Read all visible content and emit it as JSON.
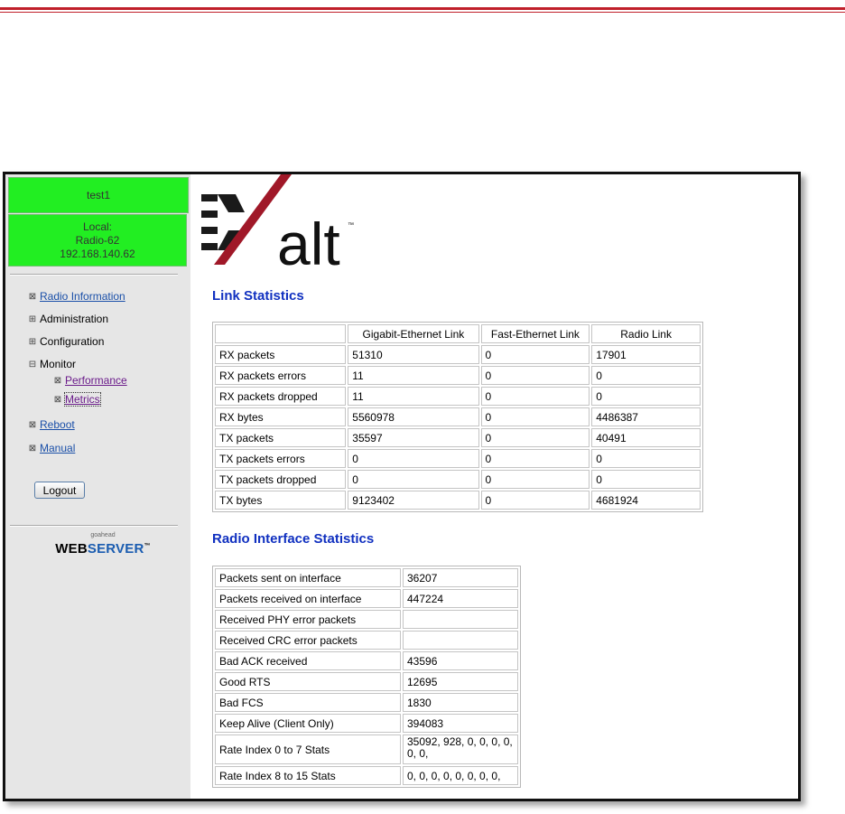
{
  "sidebar": {
    "device_name": "test1",
    "local_label": "Local:",
    "radio_name": "Radio-62",
    "ip": "192.168.140.62",
    "nav": [
      {
        "label": "Radio Information",
        "icon": "boxed-x-icon"
      },
      {
        "label": "Administration",
        "icon": "expand-plus-icon"
      },
      {
        "label": "Configuration",
        "icon": "expand-plus-icon"
      },
      {
        "label": "Monitor",
        "icon": "collapse-minus-icon"
      },
      {
        "label": "Performance",
        "icon": "boxed-x-icon"
      },
      {
        "label": "Metrics",
        "icon": "boxed-x-icon"
      },
      {
        "label": "Reboot",
        "icon": "boxed-x-icon"
      },
      {
        "label": "Manual",
        "icon": "boxed-x-icon"
      }
    ],
    "logout_label": "Logout",
    "webserver_small": "goahead",
    "webserver_web": "WEB",
    "webserver_server": "SERVER",
    "webserver_tm": "™"
  },
  "logo": {
    "text": "alt",
    "tm": "™"
  },
  "link_stats": {
    "title": "Link Statistics",
    "headers": [
      "",
      "Gigabit-Ethernet Link",
      "Fast-Ethernet Link",
      "Radio Link"
    ],
    "rows": [
      [
        "RX packets",
        "51310",
        "0",
        "17901"
      ],
      [
        "RX packets errors",
        "11",
        "0",
        "0"
      ],
      [
        "RX packets dropped",
        "11",
        "0",
        "0"
      ],
      [
        "RX bytes",
        "5560978",
        "0",
        "4486387"
      ],
      [
        "TX packets",
        "35597",
        "0",
        "40491"
      ],
      [
        "TX packets errors",
        "0",
        "0",
        "0"
      ],
      [
        "TX packets dropped",
        "0",
        "0",
        "0"
      ],
      [
        "TX bytes",
        "9123402",
        "0",
        "4681924"
      ]
    ]
  },
  "radio_stats": {
    "title": "Radio Interface Statistics",
    "rows": [
      [
        "Packets sent on interface",
        "36207"
      ],
      [
        "Packets received on interface",
        "447224"
      ],
      [
        "Received PHY error packets",
        ""
      ],
      [
        "Received CRC error packets",
        ""
      ],
      [
        "Bad ACK received",
        "43596"
      ],
      [
        "Good RTS",
        "12695"
      ],
      [
        "Bad FCS",
        "1830"
      ],
      [
        "Keep Alive (Client Only)",
        "394083"
      ],
      [
        "Rate Index 0 to 7 Stats",
        "35092, 928, 0, 0, 0, 0, 0, 0,"
      ],
      [
        "Rate Index 8 to 15 Stats",
        "0, 0, 0, 0, 0, 0, 0, 0,"
      ]
    ]
  },
  "colors": {
    "status_green": "#22ee22",
    "accent_red": "#c0202a",
    "title_blue": "#1030c0",
    "link_blue": "#1a4fa8"
  }
}
